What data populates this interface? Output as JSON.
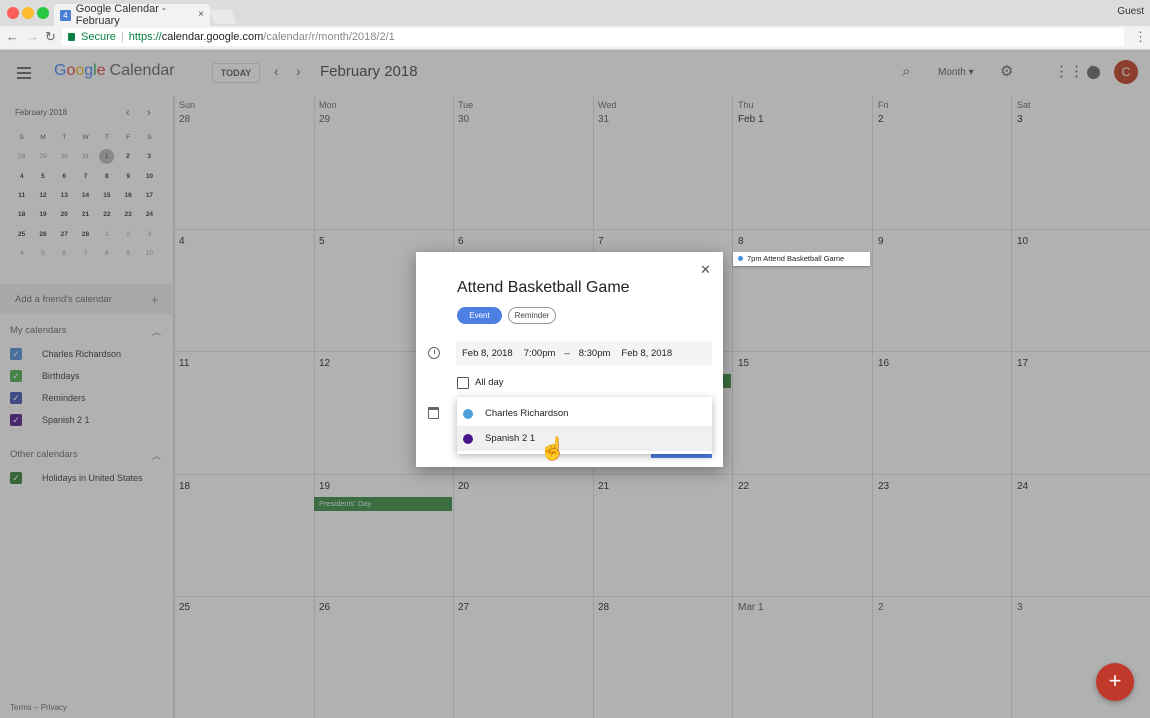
{
  "browser": {
    "tab_title": "Google Calendar - February",
    "tab_favicon": "4",
    "tab_close": "×",
    "guest_label": "Guest",
    "secure_label": "Secure",
    "url_scheme": "https://",
    "url_host": "calendar.google.com",
    "url_path": "/calendar/r/month/2018/2/1"
  },
  "header": {
    "logo_letters": [
      "G",
      "o",
      "o",
      "g",
      "l",
      "e"
    ],
    "logo_calendar": "Calendar",
    "today_label": "TODAY",
    "month_title": "February 2018",
    "view_label": "Month",
    "avatar_letter": "C"
  },
  "mini_calendar": {
    "title": "February 2018",
    "weekdays": [
      "S",
      "M",
      "T",
      "W",
      "T",
      "F",
      "S"
    ],
    "weeks": [
      [
        "28",
        "29",
        "30",
        "31",
        "1",
        "2",
        "3"
      ],
      [
        "4",
        "5",
        "6",
        "7",
        "8",
        "9",
        "10"
      ],
      [
        "11",
        "12",
        "13",
        "14",
        "15",
        "16",
        "17"
      ],
      [
        "18",
        "19",
        "20",
        "21",
        "22",
        "23",
        "24"
      ],
      [
        "25",
        "26",
        "27",
        "28",
        "1",
        "2",
        "3"
      ],
      [
        "4",
        "5",
        "6",
        "7",
        "8",
        "9",
        "10"
      ]
    ]
  },
  "sidebar": {
    "add_friend": "Add a friend's calendar",
    "my_calendars_title": "My calendars",
    "my_calendars": [
      {
        "label": "Charles Richardson",
        "color": "#4a90d9"
      },
      {
        "label": "Birthdays",
        "color": "#4caf50"
      },
      {
        "label": "Reminders",
        "color": "#3f51b5"
      },
      {
        "label": "Spanish 2 1",
        "color": "#4a148c"
      }
    ],
    "other_calendars_title": "Other calendars",
    "other_calendars": [
      {
        "label": "Holidays in United States",
        "color": "#2e7d32"
      }
    ],
    "footer_terms": "Terms",
    "footer_sep": "–",
    "footer_privacy": "Privacy"
  },
  "grid": {
    "day_names": [
      "Sun",
      "Mon",
      "Tue",
      "Wed",
      "Thu",
      "Fri",
      "Sat"
    ],
    "weeks": [
      [
        "28",
        "29",
        "30",
        "31",
        "Feb 1",
        "2",
        "3"
      ],
      [
        "4",
        "5",
        "6",
        "7",
        "8",
        "9",
        "10"
      ],
      [
        "11",
        "12",
        "",
        "",
        "15",
        "16",
        "17"
      ],
      [
        "18",
        "19",
        "20",
        "21",
        "22",
        "23",
        "24"
      ],
      [
        "25",
        "26",
        "27",
        "28",
        "Mar 1",
        "2",
        "3"
      ]
    ]
  },
  "events": {
    "basketball": "7pm Attend Basketball Game",
    "presidents": "Presidents' Day"
  },
  "dialog": {
    "title": "Attend Basketball Game",
    "event_btn": "Event",
    "reminder_btn": "Reminder",
    "start_date": "Feb 8, 2018",
    "start_time": "7:00pm",
    "dash": "–",
    "end_time": "8:30pm",
    "end_date": "Feb 8, 2018",
    "all_day": "All day",
    "calendar_options": [
      {
        "label": "Charles Richardson",
        "color": "#4a9fd8"
      },
      {
        "label": "Spanish 2 1",
        "color": "#4a148c"
      }
    ]
  }
}
